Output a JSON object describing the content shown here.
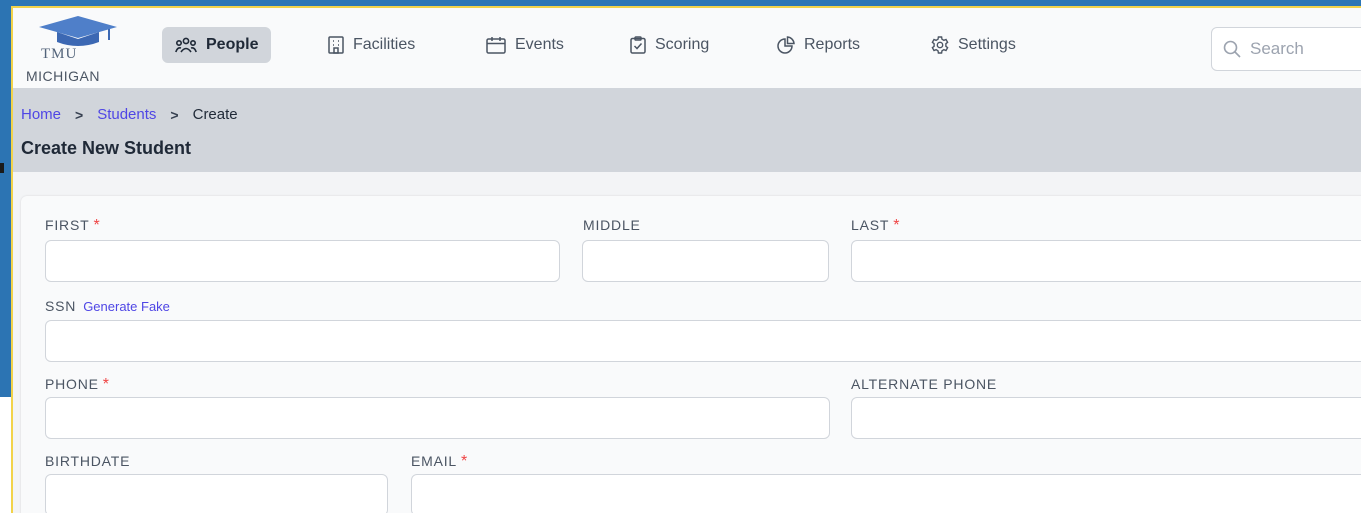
{
  "logo": {
    "line1": "TMU",
    "line2": "MICHIGAN"
  },
  "nav": {
    "people": "People",
    "facilities": "Facilities",
    "events": "Events",
    "scoring": "Scoring",
    "reports": "Reports",
    "settings": "Settings"
  },
  "search": {
    "placeholder": "Search"
  },
  "breadcrumb": {
    "home": "Home",
    "students": "Students",
    "current": "Create",
    "separator": ">"
  },
  "page_title": "Create New Student",
  "form": {
    "first_label": "FIRST",
    "middle_label": "MIDDLE",
    "last_label": "LAST",
    "ssn_label": "SSN",
    "generate_fake": "Generate Fake",
    "phone_label": "PHONE",
    "alt_phone_label": "ALTERNATE PHONE",
    "birthdate_label": "BIRTHDATE",
    "email_label": "EMAIL",
    "required_mark": "*"
  },
  "colors": {
    "accent": "#4f46e5",
    "required": "#ef4444",
    "frame_blue": "#2d76b5",
    "frame_yellow": "#f2d34a",
    "active_nav_bg": "#d1d5db"
  },
  "icons": {
    "logo": "graduation-cap-icon",
    "people": "people-icon",
    "facilities": "building-icon",
    "events": "calendar-icon",
    "scoring": "clipboard-check-icon",
    "reports": "pie-chart-icon",
    "settings": "gear-icon",
    "search": "search-icon"
  }
}
